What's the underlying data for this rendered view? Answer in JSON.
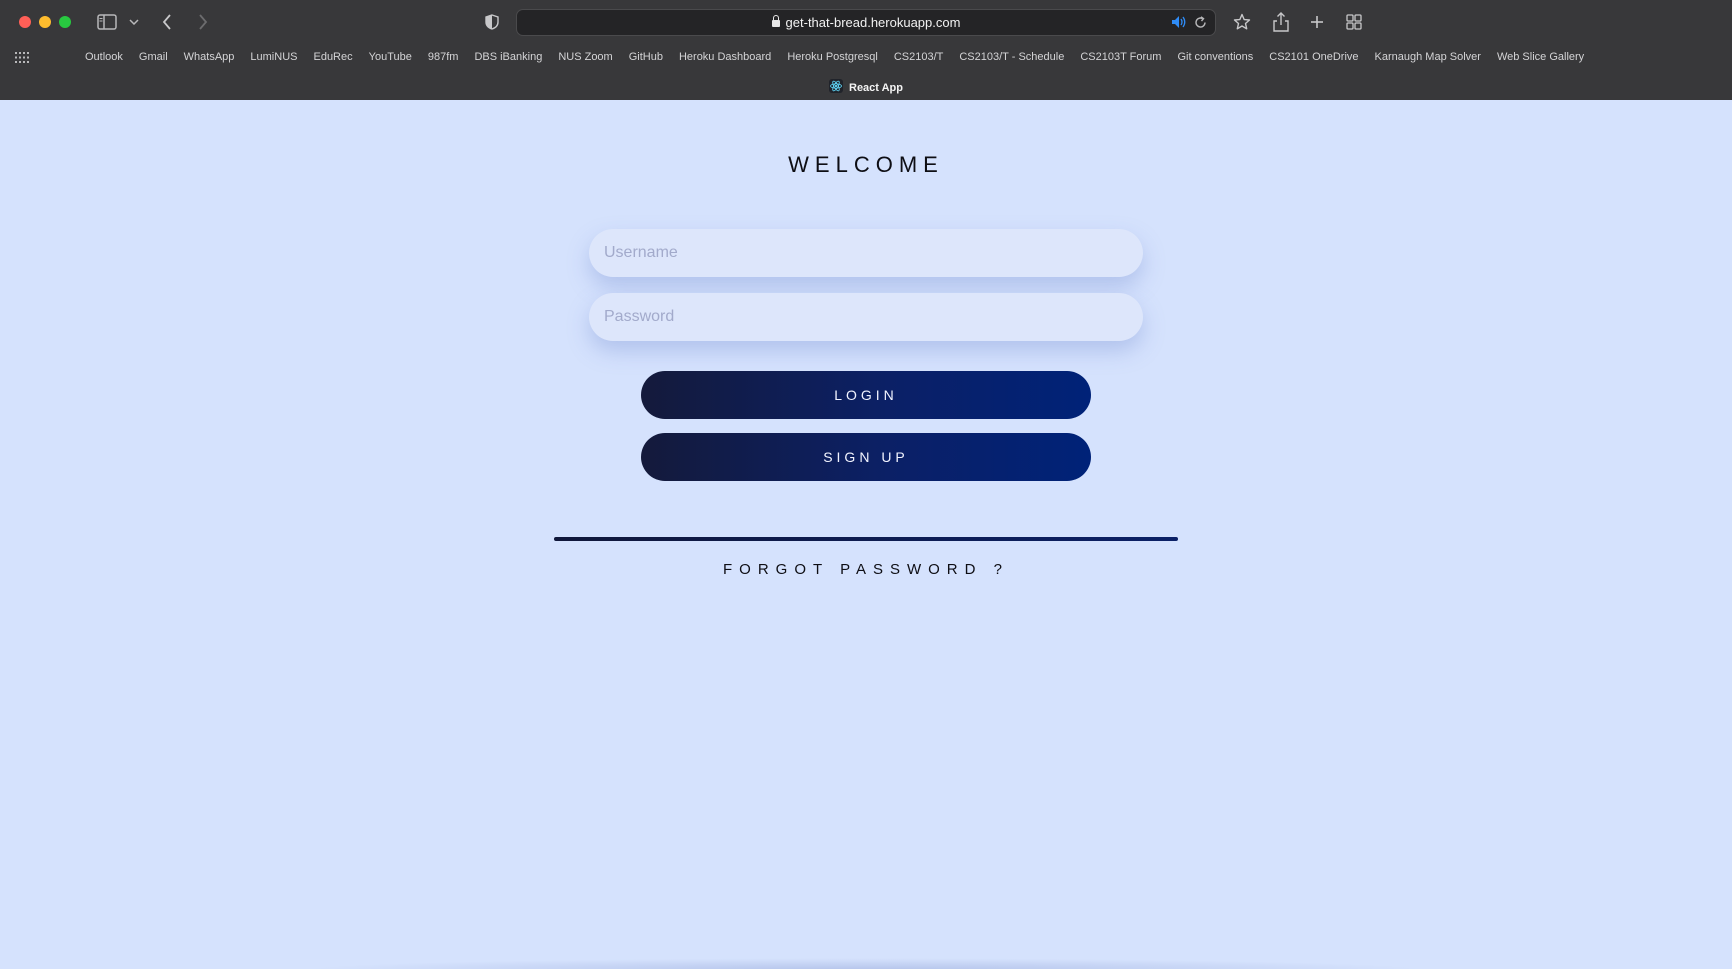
{
  "browser": {
    "url": "get-that-bread.herokuapp.com",
    "tab_title": "React App",
    "bookmarks": [
      "Outlook",
      "Gmail",
      "WhatsApp",
      "LumiNUS",
      "EduRec",
      "YouTube",
      "987fm",
      "DBS iBanking",
      "NUS Zoom",
      "GitHub",
      "Heroku Dashboard",
      "Heroku Postgresql",
      "CS2103/T",
      "CS2103/T - Schedule",
      "CS2103T Forum",
      "Git conventions",
      "CS2101 OneDrive",
      "Karnaugh Map Solver",
      "Web Slice Gallery"
    ],
    "icons": {
      "sidebar": "sidebar-icon",
      "back": "chevron-left-icon",
      "forward": "chevron-right-icon",
      "privacy": "shield-icon",
      "audio": "speaker-icon",
      "reload": "reload-icon",
      "bookmark": "star-icon",
      "share": "share-icon",
      "new_tab": "plus-icon",
      "tab_overview": "grid-icon"
    }
  },
  "login": {
    "heading": "WELCOME",
    "username_placeholder": "Username",
    "password_placeholder": "Password",
    "login_label": "LOGIN",
    "signup_label": "SIGN UP",
    "forgot_label": "FORGOT PASSWORD ?"
  },
  "colors": {
    "page_background": "#d5e2fd",
    "button_gradient_start": "#141a3b",
    "button_gradient_end": "#002278",
    "chrome_background": "#38383a"
  }
}
